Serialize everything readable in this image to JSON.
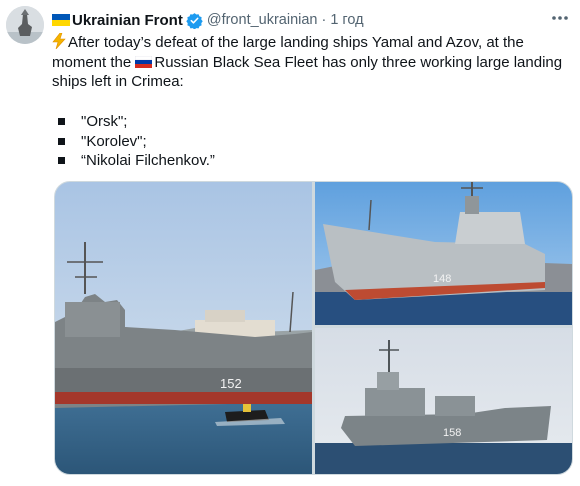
{
  "tweet": {
    "author_name": "Ukrainian Front",
    "handle": "@front_ukrainian",
    "separator": "·",
    "time": "1 год",
    "text_lines": [
      "After today’s defeat of the large landing ships Yamal and Azov, at the",
      "Russian Black Sea Fleet has only three working large landing",
      "ships left in Crimea:"
    ],
    "text_line2_prefix": "moment the ",
    "list_items": [
      "\"Orsk\";",
      "\"Korolev\";",
      "“Nikolai Filchenkov.”"
    ],
    "icons": {
      "author_flag": "ukraine-flag-icon",
      "verified": "verified-badge-icon",
      "more": "more-options-icon",
      "lightning": "lightning-emoji-icon",
      "russian_flag": "russia-flag-icon"
    },
    "colors": {
      "verified_blue": "#1d9bf0",
      "secondary_text": "#536471",
      "primary_text": "#0f1419"
    }
  },
  "photos": {
    "left": {
      "hull_number": "152"
    },
    "top_right": {
      "hull_number": "148"
    },
    "bottom_right": {
      "hull_number": "158"
    }
  }
}
